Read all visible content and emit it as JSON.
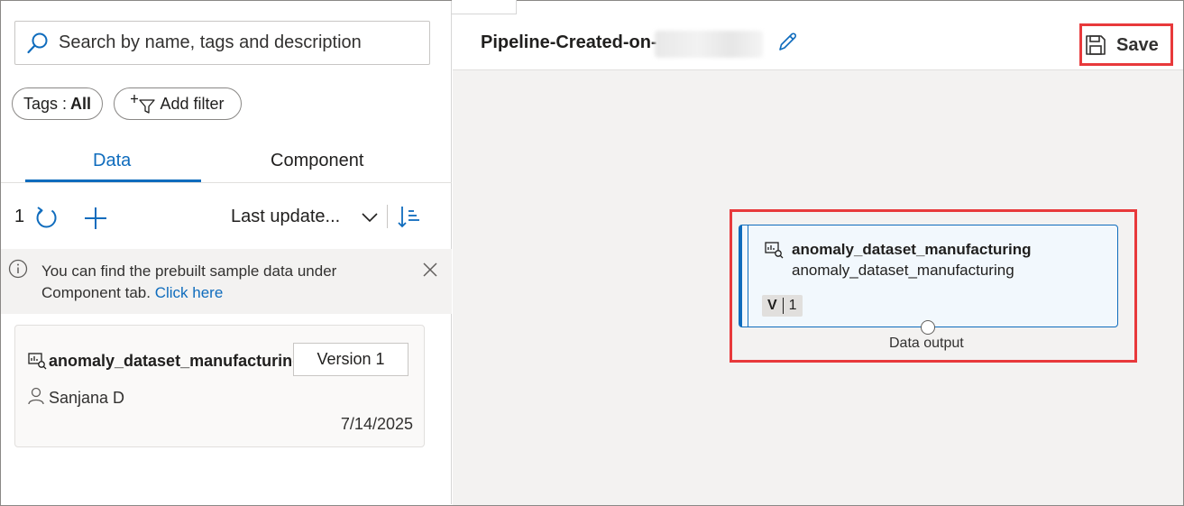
{
  "left_panel": {
    "search": {
      "placeholder": "Search by name, tags and description"
    },
    "filters": {
      "tags_label": "Tags :",
      "tags_value": "All",
      "add_filter_label": "Add filter"
    },
    "tabs": [
      {
        "label": "Data",
        "active": true
      },
      {
        "label": "Component",
        "active": false
      }
    ],
    "toolbar": {
      "count": "1",
      "sort_label": "Last update..."
    },
    "info_bar": {
      "text": "You can find the prebuilt sample data under Component tab.",
      "link": "Click here"
    },
    "data_card": {
      "title": "anomaly_dataset_manufacturing",
      "version_label": "Version 1",
      "user": "Sanjana D",
      "date": "7/14/2025"
    }
  },
  "header": {
    "pipeline_title": "Pipeline-Created-on-",
    "save_label": "Save"
  },
  "canvas": {
    "node": {
      "title": "anomaly_dataset_manufacturing",
      "subtitle": "anomaly_dataset_manufacturing",
      "version_tag": "V",
      "version_value": "1",
      "output_label": "Data output"
    }
  },
  "colors": {
    "accent": "#0f6cbd",
    "highlight": "#e8393b",
    "canvas_bg": "#f3f2f1"
  }
}
